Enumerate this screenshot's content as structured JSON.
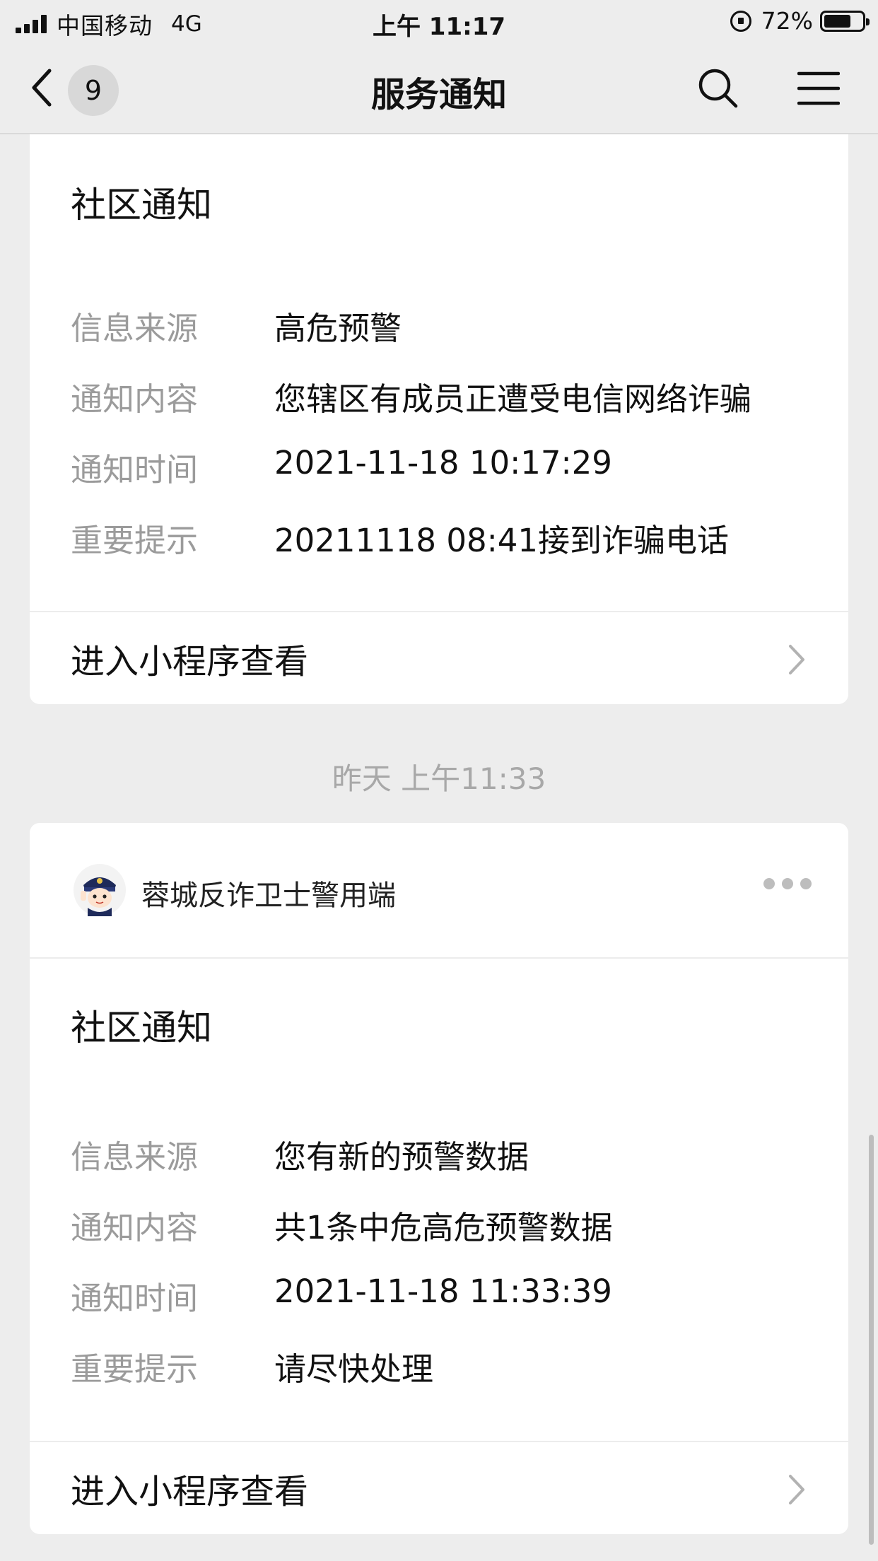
{
  "status_bar": {
    "carrier": "中国移动",
    "network": "4G",
    "time": "上午 11:17",
    "battery_percent_text": "72%",
    "battery_level": 0.72
  },
  "nav": {
    "unread_count": "9",
    "title": "服务通知",
    "icons": [
      "back-arrow-icon",
      "search-icon",
      "menu-icon"
    ]
  },
  "card1": {
    "title": "社区通知",
    "fields": [
      {
        "label": "信息来源",
        "value": "高危预警"
      },
      {
        "label": "通知内容",
        "value": "您辖区有成员正遭受电信网络诈骗"
      },
      {
        "label": "通知时间",
        "value": "2021-11-18 10:17:29"
      },
      {
        "label": "重要提示",
        "value": "20211118 08:41接到诈骗电话"
      }
    ],
    "action_label": "进入小程序查看"
  },
  "divider_time": "昨天 上午11:33",
  "card2": {
    "app_name": "蓉城反诈卫士警用端",
    "avatar_icon": "police-avatar-icon",
    "title": "社区通知",
    "fields": [
      {
        "label": "信息来源",
        "value": "您有新的预警数据"
      },
      {
        "label": "通知内容",
        "value": "共1条中危高危预警数据"
      },
      {
        "label": "通知时间",
        "value": "2021-11-18 11:33:39"
      },
      {
        "label": "重要提示",
        "value": "请尽快处理"
      }
    ],
    "action_label": "进入小程序查看"
  },
  "colors": {
    "background": "#ededed",
    "card": "#ffffff",
    "label_gray": "#9b9b9b",
    "divider_text": "#a8a8a8"
  }
}
